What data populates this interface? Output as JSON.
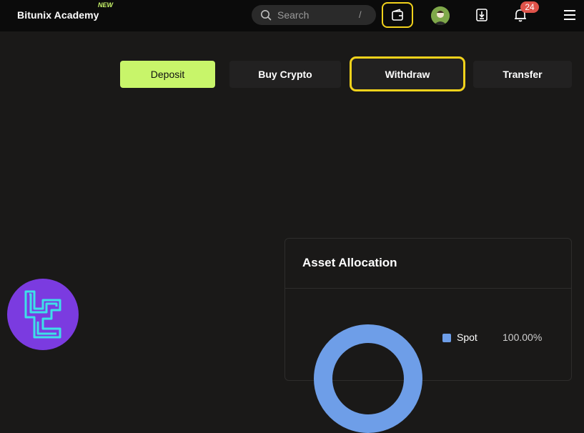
{
  "header": {
    "brand": "Bitunix Academy",
    "brand_badge": "NEW",
    "search": {
      "placeholder": "Search",
      "shortcut": "/"
    },
    "notifications_count": "24"
  },
  "actions": {
    "deposit": "Deposit",
    "buy_crypto": "Buy Crypto",
    "withdraw": "Withdraw",
    "transfer": "Transfer"
  },
  "asset_allocation": {
    "title": "Asset Allocation",
    "legend": [
      {
        "name": "Spot",
        "percent": "100.00%",
        "color": "#6e9ee8"
      }
    ]
  },
  "colors": {
    "accent_green": "#c8f56a",
    "highlight_yellow": "#f2d21b",
    "notification_red": "#e0534a",
    "logo_purple": "#7b3be0"
  },
  "icons": [
    "search-icon",
    "wallet-icon",
    "avatar",
    "download-icon",
    "bell-icon",
    "menu-icon",
    "brand-logo"
  ]
}
